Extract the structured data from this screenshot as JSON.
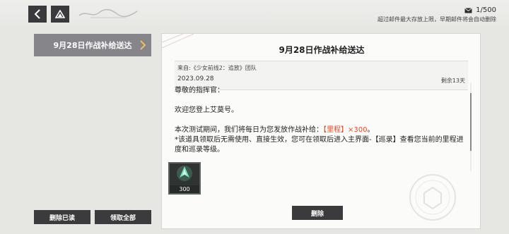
{
  "header": {
    "mail_count": "1/500",
    "overflow_note": "超过邮件最大存放上限，早期邮件将会自动删除"
  },
  "mail_list": {
    "items": [
      {
        "title": "9月28日作战补给送达"
      }
    ]
  },
  "actions": {
    "delete_read": "删除已读",
    "claim_all": "领取全部"
  },
  "mail": {
    "title": "9月28日作战补给送达",
    "from": "来自:《少女前线2：追放》团队",
    "date": "2023.09.28",
    "remaining": "剩余13天",
    "greeting": "尊敬的指挥官：",
    "welcome": "欢迎您登上艾莫号。",
    "line1_pre": "本次测试期间，我们将每日为您发放作战补给：",
    "line1_item": "【里程】×300",
    "line1_post": "。",
    "line2": "*该道具领取后无需使用、直接生效，您可在领取后进入主界面-【巡录】查看您当前的里程进度和巡录等级。",
    "attachment": {
      "count": "300",
      "icon": "mileage-crystal-icon"
    },
    "delete_label": "删除"
  }
}
